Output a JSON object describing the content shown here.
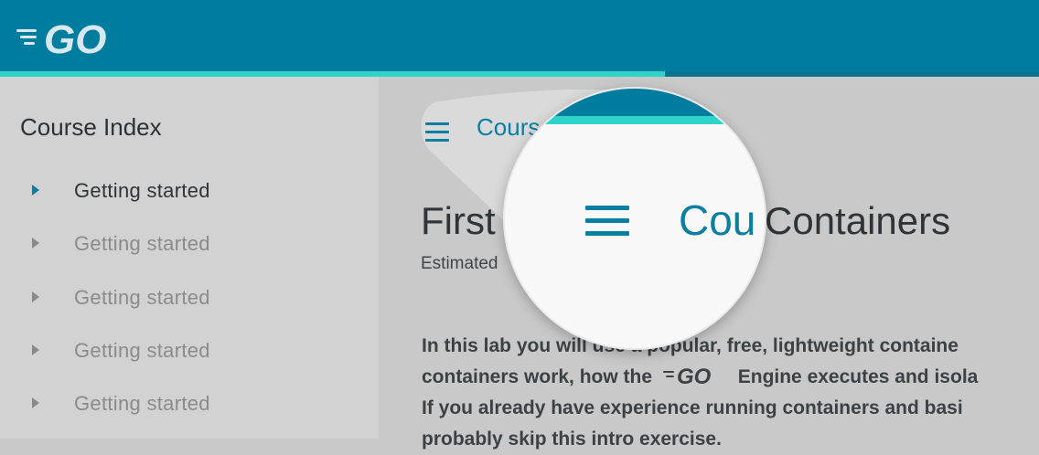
{
  "header": {
    "logo_text": "GO",
    "progress_percent": 64
  },
  "sidebar": {
    "title": "Course Index",
    "items": [
      {
        "label": "Getting started",
        "active": true
      },
      {
        "label": "Getting started",
        "active": false
      },
      {
        "label": "Getting started",
        "active": false
      },
      {
        "label": "Getting started",
        "active": false
      },
      {
        "label": "Getting started",
        "active": false
      }
    ]
  },
  "main": {
    "breadcrumb_partial": "Cours",
    "title_left": "First",
    "title_right": "Containers",
    "estimated": "Estimated",
    "intro_line1": "In this lab you will use a popular, free, lightweight containe",
    "intro_line2_a": "containers work, how the",
    "intro_line2_logo": "GO",
    "intro_line2_b": "Engine executes and isola",
    "intro_line3": "If you already have experience running containers and basi",
    "intro_line4": "probably skip this intro exercise."
  },
  "magnifier": {
    "word": "Cou"
  },
  "colors": {
    "brand": "#007c9e",
    "accent": "#2ed3c9",
    "link": "#0b7fa2"
  }
}
